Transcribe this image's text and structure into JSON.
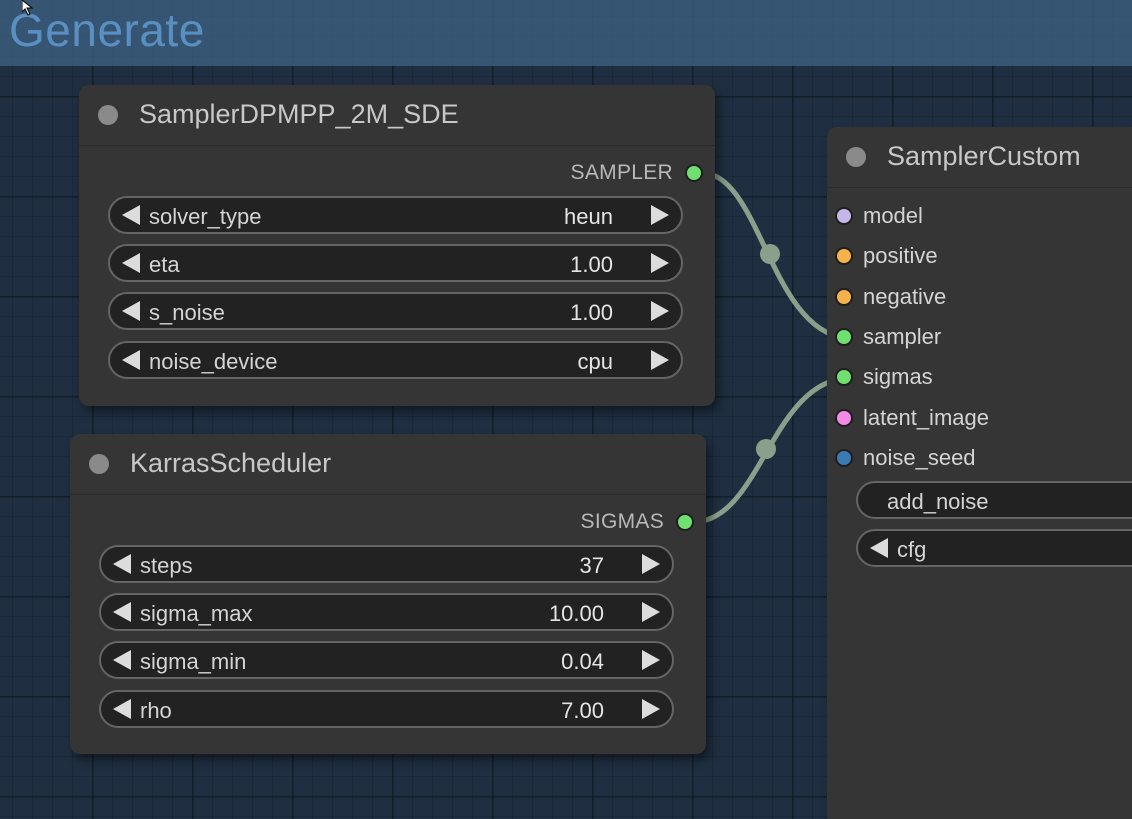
{
  "group": {
    "title": "Generate"
  },
  "colors": {
    "sampler_slot": "#6fe06f",
    "sigmas_slot": "#6fe06f",
    "model_slot": "#c4b6e8",
    "conditioning_slot": "#f6b24a",
    "latent_slot": "#f48ae8",
    "int_slot": "#3a7bb6",
    "link": "#8aa08a"
  },
  "nodes": {
    "sampler_dpmpp": {
      "title": "SamplerDPMPP_2M_SDE",
      "output_label": "SAMPLER",
      "widgets": [
        {
          "name": "solver_type",
          "value": "heun"
        },
        {
          "name": "eta",
          "value": "1.00"
        },
        {
          "name": "s_noise",
          "value": "1.00"
        },
        {
          "name": "noise_device",
          "value": "cpu"
        }
      ]
    },
    "karras": {
      "title": "KarrasScheduler",
      "output_label": "SIGMAS",
      "widgets": [
        {
          "name": "steps",
          "value": "37"
        },
        {
          "name": "sigma_max",
          "value": "10.00"
        },
        {
          "name": "sigma_min",
          "value": "0.04"
        },
        {
          "name": "rho",
          "value": "7.00"
        }
      ]
    },
    "sampler_custom": {
      "title": "SamplerCustom",
      "inputs": [
        {
          "label": "model",
          "type": "model"
        },
        {
          "label": "positive",
          "type": "conditioning"
        },
        {
          "label": "negative",
          "type": "conditioning"
        },
        {
          "label": "sampler",
          "type": "sampler"
        },
        {
          "label": "sigmas",
          "type": "sigmas"
        },
        {
          "label": "latent_image",
          "type": "latent"
        },
        {
          "label": "noise_seed",
          "type": "int"
        }
      ],
      "widgets": [
        {
          "name": "add_noise"
        },
        {
          "name": "cfg"
        }
      ]
    }
  }
}
